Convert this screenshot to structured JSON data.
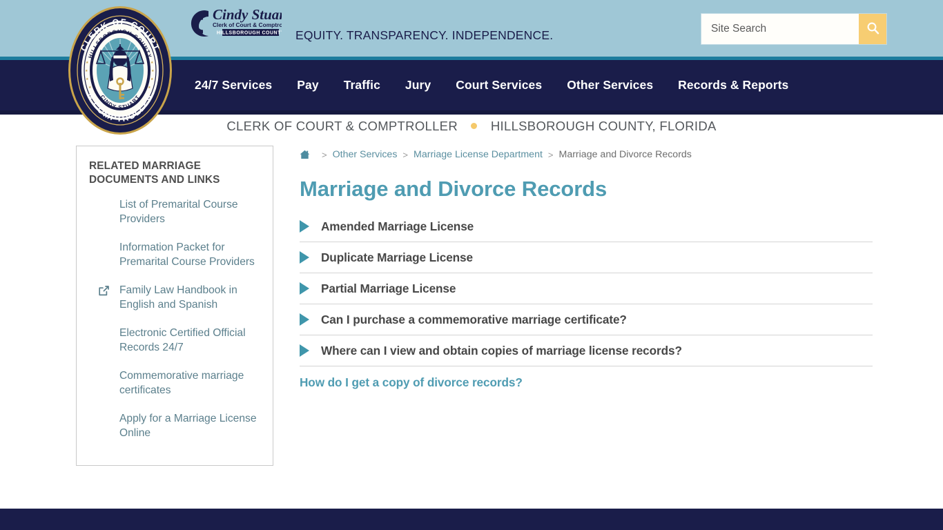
{
  "header": {
    "tagline": "EQUITY. TRANSPARENCY. INDEPENDENCE.",
    "logo_name": "Cindy Stuart",
    "logo_subtitle": "Clerk of Court & Comptroller",
    "logo_county": "HILLSBOROUGH COUNTY",
    "seal_outer_top": "CLERK OF COURT",
    "seal_outer_bottom": "& COMPTROLLER",
    "seal_inner_top": "HILLSBOROUGH COUNTY",
    "seal_inner_bottom": "CINDY STUART",
    "colors": {
      "band": "#9fc7d6",
      "stripe": "#1d7d9e",
      "navy": "#1a1d4a",
      "accent_yellow": "#f7cd72",
      "teal": "#4f9cb2"
    }
  },
  "search": {
    "placeholder": "Site Search",
    "value": "",
    "icon": "search-icon",
    "button_label": ""
  },
  "nav": {
    "items": [
      {
        "label": "24/7 Services"
      },
      {
        "label": "Pay"
      },
      {
        "label": "Traffic"
      },
      {
        "label": "Jury"
      },
      {
        "label": "Court Services"
      },
      {
        "label": "Other Services"
      },
      {
        "label": "Records & Reports"
      }
    ]
  },
  "subtitle": {
    "left": "CLERK OF COURT & COMPTROLLER",
    "right": "HILLSBOROUGH COUNTY, FLORIDA"
  },
  "sidebar": {
    "title": "RELATED MARRIAGE DOCUMENTS AND LINKS",
    "links": [
      {
        "label": "List of Premarital Course Providers",
        "icon": null
      },
      {
        "label": "Information Packet for Premarital Course Providers",
        "icon": null
      },
      {
        "label": "Family Law Handbook in English and Spanish",
        "icon": "external-link-icon"
      },
      {
        "label": "Electronic Certified Official Records 24/7",
        "icon": null
      },
      {
        "label": "Commemorative marriage certificates",
        "icon": null
      },
      {
        "label": "Apply for a Marriage License Online",
        "icon": null
      }
    ]
  },
  "breadcrumb": {
    "home_icon": "home-icon",
    "separator": ">",
    "items": [
      {
        "label": "Other Services",
        "current": false
      },
      {
        "label": "Marriage License Department",
        "current": false
      },
      {
        "label": "Marriage and Divorce Records",
        "current": true
      }
    ]
  },
  "main": {
    "page_title": "Marriage and Divorce Records",
    "accordion": [
      {
        "label": "Amended Marriage License"
      },
      {
        "label": "Duplicate Marriage License"
      },
      {
        "label": "Partial Marriage License"
      },
      {
        "label": "Can I purchase a commemorative marriage certificate?"
      },
      {
        "label": "Where can I view and obtain copies of marriage license records?"
      }
    ],
    "divorce_link": "How do I get a copy of divorce records?"
  }
}
